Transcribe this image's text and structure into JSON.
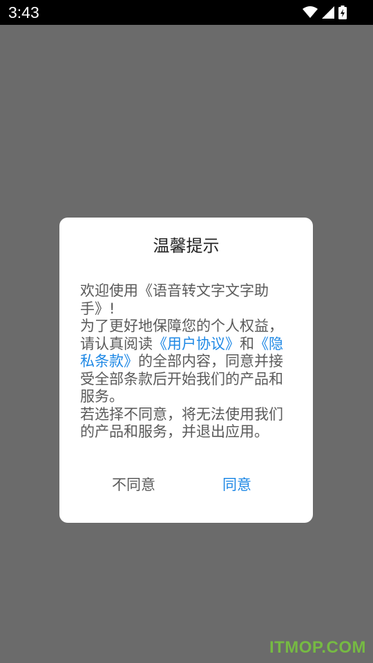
{
  "status_bar": {
    "time": "3:43",
    "icons": [
      "wifi-icon",
      "cellular-signal-icon",
      "battery-charging-icon"
    ]
  },
  "dialog": {
    "title": "温馨提示",
    "body": {
      "greeting_line": "欢迎使用《语音转文字文字助手》!",
      "line2_prefix": "为了更好地保障您的个人权益，请认真阅读",
      "user_agreement_link": "《用户协议》",
      "connector": "和",
      "privacy_policy_link": "《隐私条款》",
      "line2_suffix": "的全部内容，同意并接受全部条款后开始我们的产品和服务。",
      "disagree_notice": "若选择不同意，将无法使用我们的产品和服务，并退出应用。"
    },
    "buttons": {
      "disagree": "不同意",
      "agree": "同意"
    }
  },
  "watermark": "ITMOP.COM",
  "colors": {
    "overlay": "#6b6b6b",
    "link": "#1e88e5",
    "watermark": "#78c83c"
  }
}
